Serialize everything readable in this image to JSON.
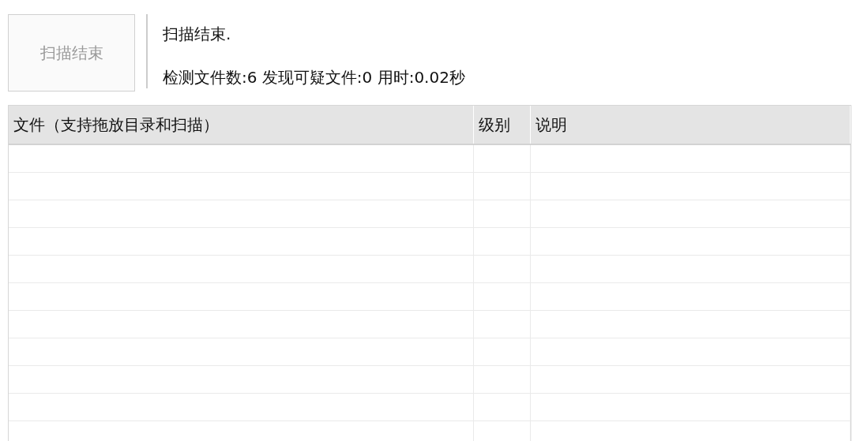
{
  "scan_button": {
    "label": "扫描结束",
    "disabled": true
  },
  "status_lines": [
    "扫描结束.",
    "检测文件数:6 发现可疑文件:0 用时:0.02秒"
  ],
  "table": {
    "columns": [
      "文件（支持拖放目录和扫描）",
      "级别",
      "说明"
    ]
  }
}
